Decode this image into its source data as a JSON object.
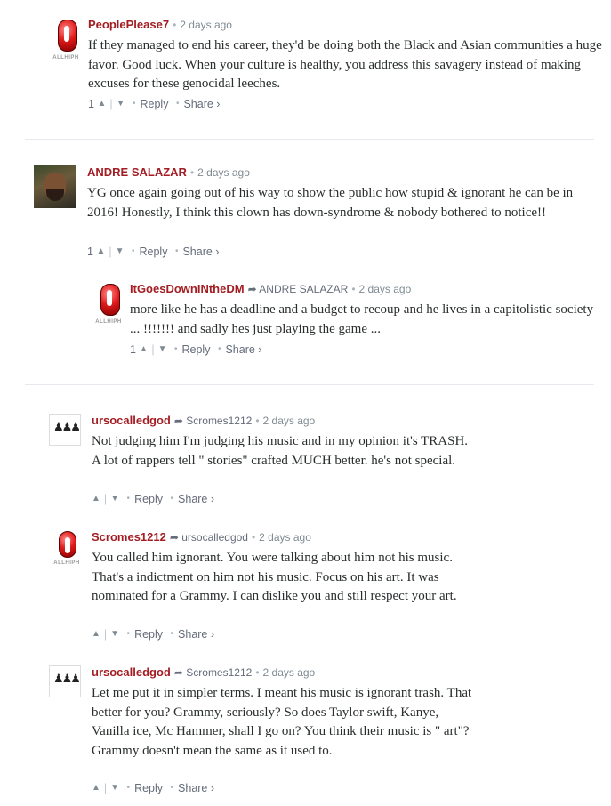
{
  "comments": [
    {
      "author": "PeoplePlease7",
      "reply_to": "",
      "time": "2 days ago",
      "avatar_icon": "pill-logo-avatar",
      "avatar_label": "ALLHIPH",
      "body": "If they managed to end his career, they'd be doing both the Black and Asian communities a huge favor. Good luck. When your culture is healthy, you address this savagery instead of making excuses for these genocidal leeches.",
      "upvotes": "1",
      "reply_label": "Reply",
      "share_label": "Share ›"
    },
    {
      "author": "ANDRE SALAZAR",
      "reply_to": "",
      "time": "2 days ago",
      "avatar_icon": "photo-avatar",
      "body": "YG once again going out of his way to show the public how stupid & ignorant he can be in 2016! Honestly, I think this clown has down-syndrome & nobody bothered to notice!!",
      "upvotes": "1",
      "reply_label": "Reply",
      "share_label": "Share ›"
    },
    {
      "author": "ItGoesDownINtheDM",
      "reply_to": "ANDRE SALAZAR",
      "time": "2 days ago",
      "avatar_icon": "pill-logo-avatar",
      "avatar_label": "ALLHIPH",
      "body": "more like he has a deadline and a budget to recoup and he lives in a capitolistic society ... !!!!!!! and sadly hes just playing the game ...",
      "upvotes": "1",
      "reply_label": "Reply",
      "share_label": "Share ›"
    },
    {
      "author": "ursocalledgod",
      "reply_to": "Scromes1212",
      "time": "2 days ago",
      "avatar_icon": "chess-avatar",
      "body": "Not judging him I'm judging his music and in my opinion it's TRASH. A lot of rappers tell \" stories\" crafted MUCH better. he's not special.",
      "upvotes": "",
      "reply_label": "Reply",
      "share_label": "Share ›"
    },
    {
      "author": "Scromes1212",
      "reply_to": "ursocalledgod",
      "time": "2 days ago",
      "avatar_icon": "pill-logo-avatar",
      "avatar_label": "ALLHIPH",
      "body": "You called him ignorant. You were talking about him not his music. That's a indictment on him not his music. Focus on his art. It was nominated for a Grammy. I can dislike you and still respect your art.",
      "upvotes": "",
      "reply_label": "Reply",
      "share_label": "Share ›"
    },
    {
      "author": "ursocalledgod",
      "reply_to": "Scromes1212",
      "time": "2 days ago",
      "avatar_icon": "chess-avatar",
      "body": "Let me put it in simpler terms. I meant his music is ignorant trash. That better for you? Grammy, seriously? So does Taylor swift, Kanye, Vanilla ice, Mc Hammer, shall I go on? You think their music is \" art\"? Grammy doesn't mean the same as it used to.",
      "upvotes": "",
      "reply_label": "Reply",
      "share_label": "Share ›"
    }
  ],
  "colors": {
    "author": "#a31d23",
    "meta": "#7f8b92",
    "body": "#2a2e2e",
    "divider": "#e7e9ee"
  }
}
